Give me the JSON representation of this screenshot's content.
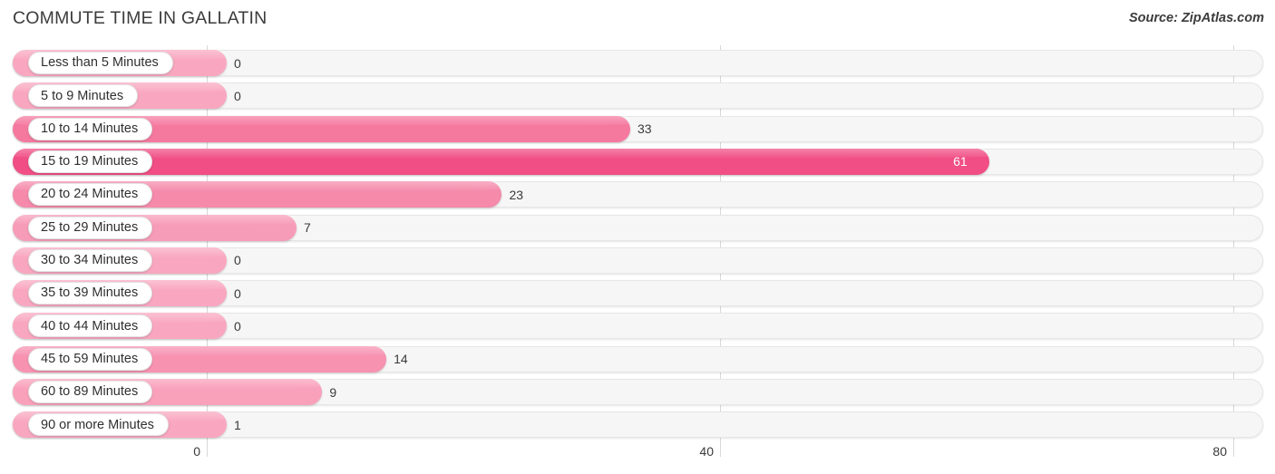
{
  "header": {
    "title": "COMMUTE TIME IN GALLATIN",
    "source": "Source: ZipAtlas.com"
  },
  "chart_data": {
    "type": "bar",
    "orientation": "horizontal",
    "title": "COMMUTE TIME IN GALLATIN",
    "xlabel": "",
    "ylabel": "",
    "xlim": [
      0,
      80
    ],
    "xticks": [
      0,
      40,
      80
    ],
    "xtick_labels": [
      "0",
      "40",
      "80"
    ],
    "grid": true,
    "legend": false,
    "categories": [
      "Less than 5 Minutes",
      "5 to 9 Minutes",
      "10 to 14 Minutes",
      "15 to 19 Minutes",
      "20 to 24 Minutes",
      "25 to 29 Minutes",
      "30 to 34 Minutes",
      "35 to 39 Minutes",
      "40 to 44 Minutes",
      "45 to 59 Minutes",
      "60 to 89 Minutes",
      "90 or more Minutes"
    ],
    "values": [
      0,
      0,
      33,
      61,
      23,
      7,
      0,
      0,
      0,
      14,
      9,
      1
    ],
    "value_labels": [
      "0",
      "0",
      "33",
      "61",
      "23",
      "7",
      "0",
      "0",
      "0",
      "14",
      "9",
      "1"
    ],
    "bar_colors": [
      "#f9a7c0",
      "#f9a7c0",
      "#f5799f",
      "#f04e84",
      "#f58aab",
      "#f79cb8",
      "#f9a7c0",
      "#f9a7c0",
      "#f9a7c0",
      "#f792b1",
      "#f9a0bb",
      "#f9a7c0"
    ],
    "label_inside": [
      false,
      false,
      false,
      true,
      false,
      false,
      false,
      false,
      false,
      false,
      false,
      false
    ]
  },
  "colors": {
    "track": "#f6f6f6",
    "track_border": "#e6e6e6",
    "gridline": "#d8d8d8",
    "text": "#3a3a3a",
    "accent_max": "#f04e84",
    "accent_min": "#f9a7c0"
  }
}
